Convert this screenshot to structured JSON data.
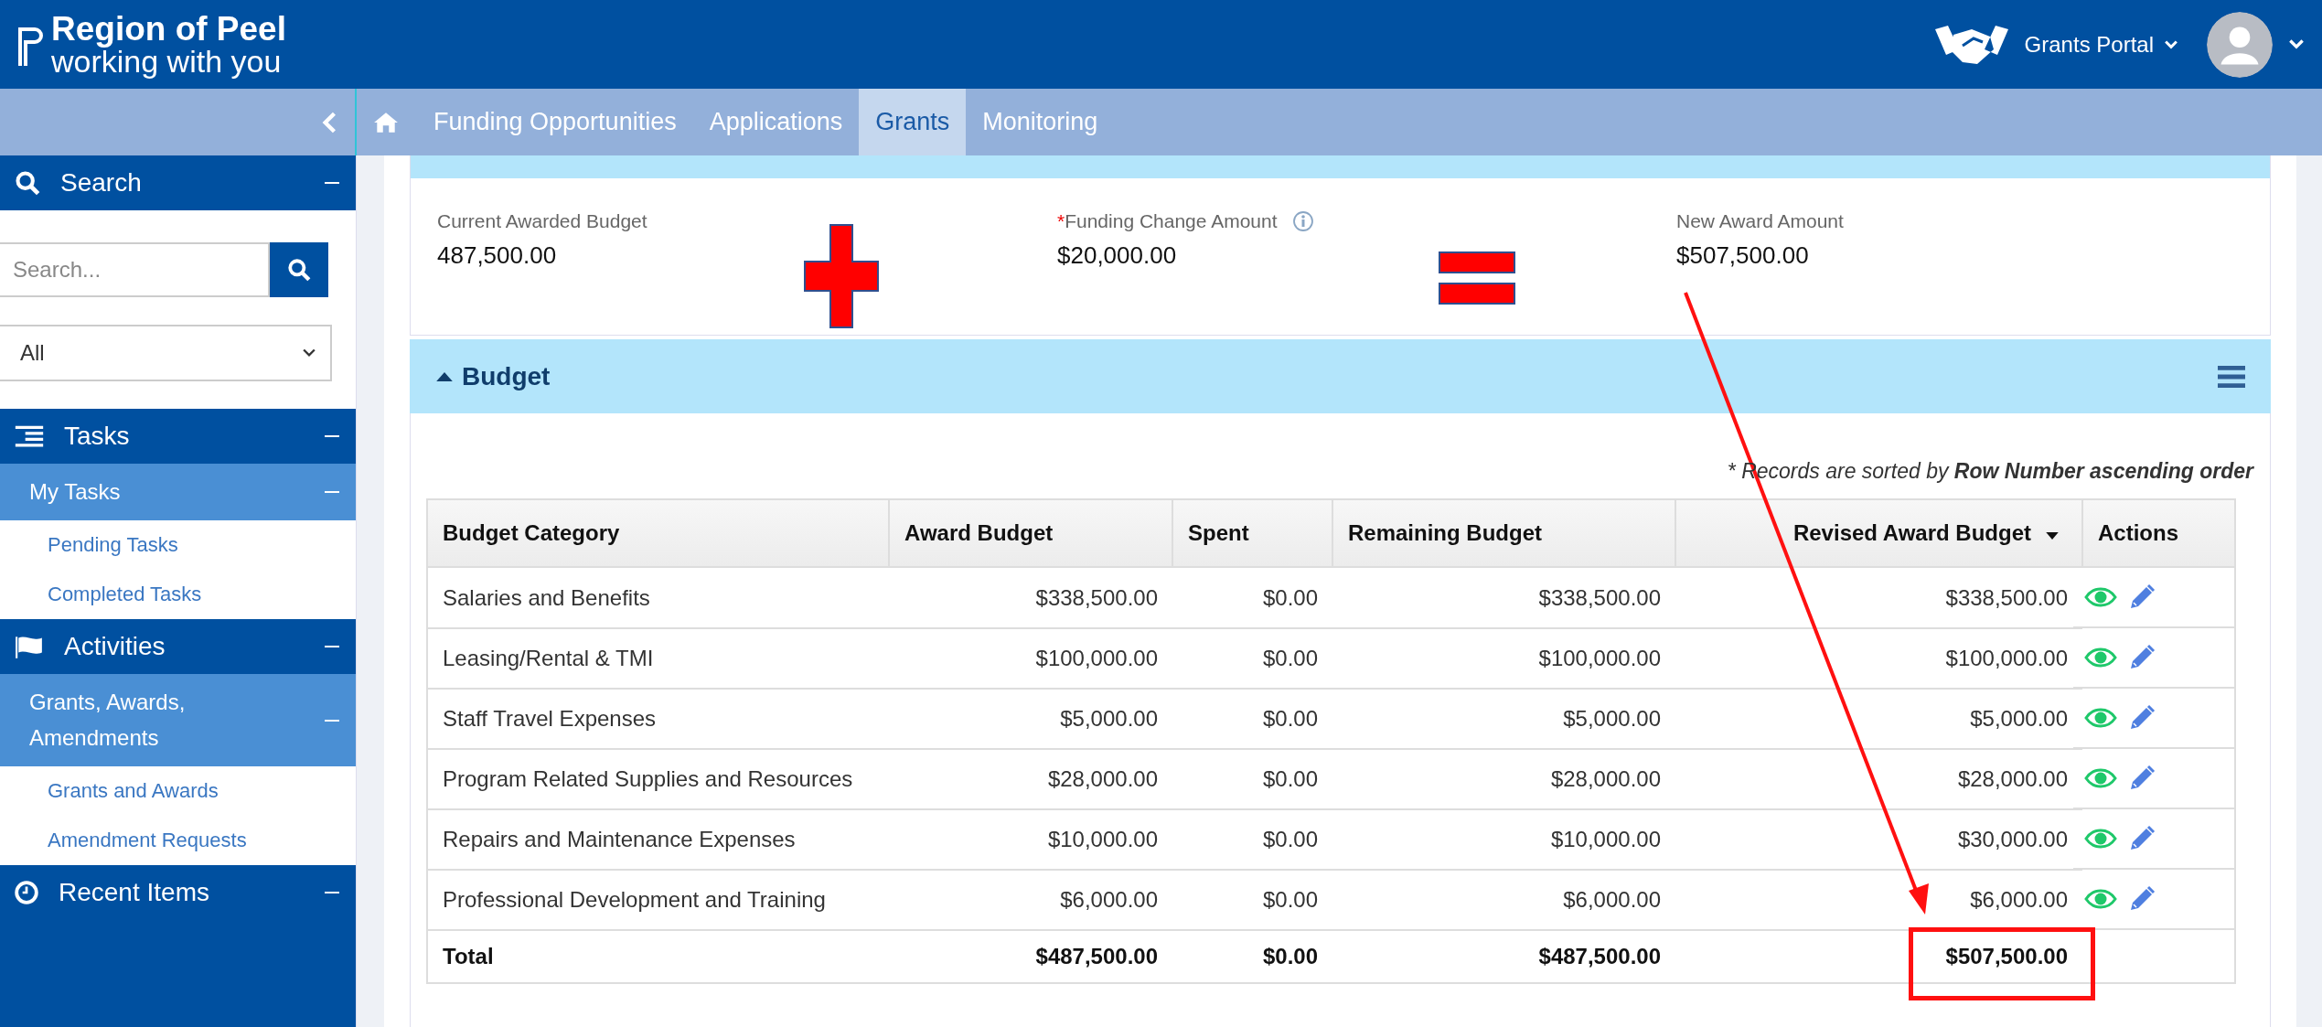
{
  "header": {
    "logo_title": "Region of Peel",
    "logo_tagline": "working with you",
    "portal": "Grants Portal"
  },
  "nav": {
    "tabs": [
      {
        "label": "Funding Opportunities",
        "selected": false
      },
      {
        "label": "Applications",
        "selected": false
      },
      {
        "label": "Grants",
        "selected": true
      },
      {
        "label": "Monitoring",
        "selected": false
      }
    ]
  },
  "sidebar": {
    "sections": [
      {
        "kind": "search",
        "title": "Search",
        "expanded": true,
        "placeholder": "Search...",
        "filter": "All"
      },
      {
        "kind": "tasks",
        "title": "Tasks",
        "expanded": true,
        "groups": [
          {
            "title": "My Tasks",
            "expanded": true,
            "items": [
              "Pending Tasks",
              "Completed Tasks"
            ]
          }
        ]
      },
      {
        "kind": "activities",
        "title": "Activities",
        "expanded": true,
        "groups": [
          {
            "title": "Grants, Awards, Amendments",
            "expanded": true,
            "items": [
              "Grants and Awards",
              "Amendment Requests"
            ]
          }
        ]
      },
      {
        "kind": "recent",
        "title": "Recent Items",
        "expanded": true
      }
    ]
  },
  "funding_change": {
    "fields": [
      {
        "label": "Current Awarded Budget",
        "value": "487,500.00",
        "info": false
      },
      {
        "required_mark": "*",
        "label": "Funding Change Amount",
        "value": "$20,000.00",
        "info": true
      },
      {
        "label": "New Award Amount",
        "value": "$507,500.00",
        "info": false
      }
    ]
  },
  "budget": {
    "title": "Budget",
    "expanded": true,
    "sort_note": "* Records are sorted by **Row Number ascending order**",
    "columns": [
      "Budget Category",
      "Award Budget",
      "Spent",
      "Remaining Budget",
      "Revised Award Budget",
      "Actions"
    ],
    "rows": [
      {
        "cells": [
          "Salaries and Benefits",
          "$338,500.00",
          "$0.00",
          "$338,500.00",
          "$338,500.00"
        ]
      },
      {
        "cells": [
          "Leasing/Rental & TMI",
          "$100,000.00",
          "$0.00",
          "$100,000.00",
          "$100,000.00"
        ]
      },
      {
        "cells": [
          "Staff Travel Expenses",
          "$5,000.00",
          "$0.00",
          "$5,000.00",
          "$5,000.00"
        ]
      },
      {
        "cells": [
          "Program Related Supplies and Resources",
          "$28,000.00",
          "$0.00",
          "$28,000.00",
          "$28,000.00"
        ]
      },
      {
        "cells": [
          "Repairs and Maintenance Expenses",
          "$10,000.00",
          "$0.00",
          "$10,000.00",
          "$30,000.00"
        ]
      },
      {
        "cells": [
          "Professional Development and Training",
          "$6,000.00",
          "$0.00",
          "$6,000.00",
          "$6,000.00"
        ]
      }
    ],
    "total": {
      "cells": [
        "Total",
        "$487,500.00",
        "$0.00",
        "$487,500.00",
        "$507,500.00"
      ]
    }
  }
}
